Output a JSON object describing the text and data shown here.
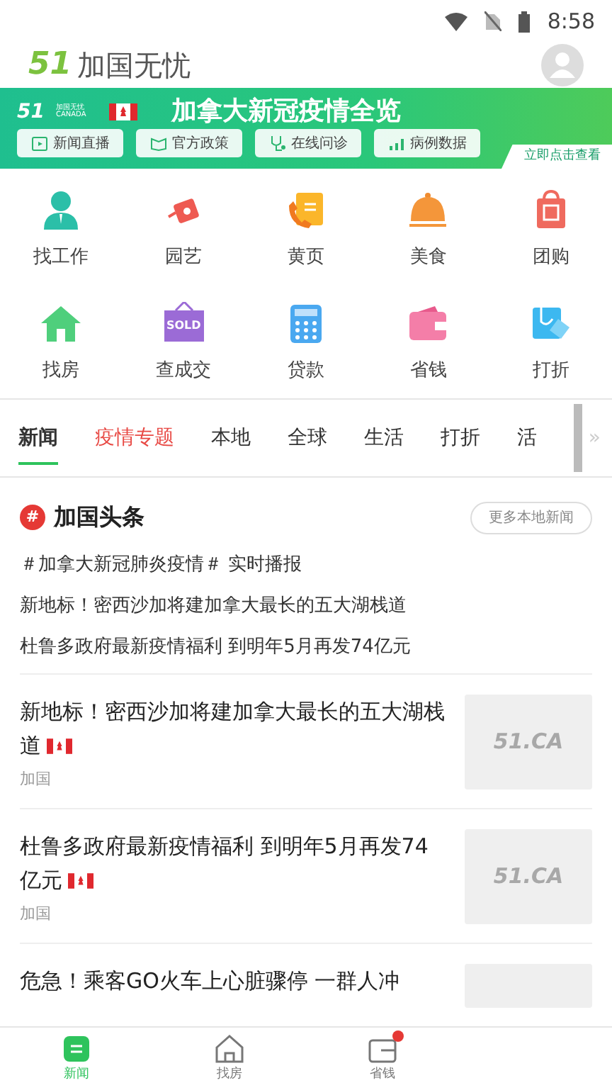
{
  "status_bar": {
    "time": "8:58"
  },
  "header": {
    "logo_mark": "51",
    "title": "加国无忧"
  },
  "banner": {
    "brand_mark": "51",
    "brand_name": "加国无忧",
    "brand_sub": "CANADA",
    "title": "加拿大新冠疫情全览",
    "cta": "立即点击查看",
    "chips": [
      {
        "label": "新闻直播",
        "kind": "tv"
      },
      {
        "label": "官方政策",
        "kind": "book"
      },
      {
        "label": "在线问诊",
        "kind": "stetho"
      },
      {
        "label": "病例数据",
        "kind": "chart"
      }
    ]
  },
  "shortcuts": [
    {
      "label": "找工作",
      "kind": "person"
    },
    {
      "label": "园艺",
      "kind": "can"
    },
    {
      "label": "黄页",
      "kind": "phone"
    },
    {
      "label": "美食",
      "kind": "cloche"
    },
    {
      "label": "团购",
      "kind": "bag"
    },
    {
      "label": "找房",
      "kind": "house"
    },
    {
      "label": "查成交",
      "kind": "sold",
      "sign": "SOLD"
    },
    {
      "label": "贷款",
      "kind": "calc"
    },
    {
      "label": "省钱",
      "kind": "wallet"
    },
    {
      "label": "打折",
      "kind": "tag"
    }
  ],
  "tabs": [
    {
      "label": "新闻",
      "selected": true,
      "highlight": false
    },
    {
      "label": "疫情专题",
      "selected": false,
      "highlight": true
    },
    {
      "label": "本地",
      "selected": false,
      "highlight": false
    },
    {
      "label": "全球",
      "selected": false,
      "highlight": false
    },
    {
      "label": "生活",
      "selected": false,
      "highlight": false
    },
    {
      "label": "打折",
      "selected": false,
      "highlight": false
    },
    {
      "label": "活",
      "selected": false,
      "highlight": false
    }
  ],
  "tabs_more": "»",
  "headlines": {
    "badge": "#",
    "title": "加国头条",
    "more": "更多本地新闻",
    "items": [
      "＃加拿大新冠肺炎疫情＃ 实时播报",
      "新地标！密西沙加将建加拿大最长的五大湖栈道",
      "杜鲁多政府最新疫情福利 到明年5月再发74亿元"
    ]
  },
  "news": [
    {
      "title": "新地标！密西沙加将建加拿大最长的五大湖栈道",
      "flag": true,
      "source": "加国",
      "thumb": "51.CA"
    },
    {
      "title": "杜鲁多政府最新疫情福利 到明年5月再发74亿元",
      "flag": true,
      "source": "加国",
      "thumb": "51.CA"
    },
    {
      "title": "危急！乘客GO火车上心脏骤停 一群人冲",
      "flag": false
    }
  ],
  "bottom_nav": [
    {
      "label": "新闻",
      "kind": "news",
      "selected": true,
      "dot": false
    },
    {
      "label": "找房",
      "kind": "house",
      "selected": false,
      "dot": false
    },
    {
      "label": "省钱",
      "kind": "wallet",
      "selected": false,
      "dot": true
    }
  ]
}
